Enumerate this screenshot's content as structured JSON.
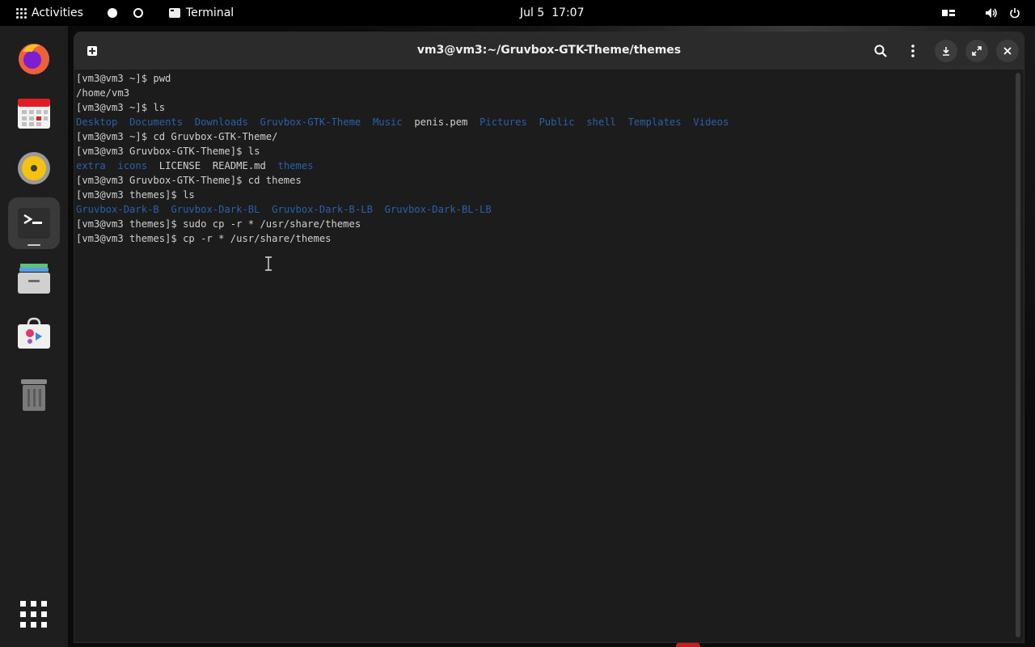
{
  "topbar": {
    "activities": "Activities",
    "app_name": "Terminal",
    "clock": "Jul 5  17:07"
  },
  "dock": {
    "items": [
      "firefox-icon",
      "calendar-icon",
      "rhythmbox-icon",
      "terminal-icon",
      "files-icon",
      "software-icon",
      "trash-icon",
      "app-grid-icon"
    ]
  },
  "window": {
    "title": "vm3@vm3:~/Gruvbox-GTK-Theme/themes"
  },
  "terminal": {
    "lines": [
      {
        "text": "[vm3@vm3 ~]$ pwd"
      },
      {
        "text": "/home/vm3"
      },
      {
        "text": "[vm3@vm3 ~]$ ls"
      },
      {
        "ls": [
          {
            "name": "Desktop",
            "type": "dir"
          },
          {
            "name": "Documents",
            "type": "dir"
          },
          {
            "name": "Downloads",
            "type": "dir"
          },
          {
            "name": "Gruvbox-GTK-Theme",
            "type": "dir"
          },
          {
            "name": "Music",
            "type": "dir"
          },
          {
            "name": "penis.pem",
            "type": "file"
          },
          {
            "name": "Pictures",
            "type": "dir"
          },
          {
            "name": "Public",
            "type": "dir"
          },
          {
            "name": "shell",
            "type": "dir"
          },
          {
            "name": "Templates",
            "type": "dir"
          },
          {
            "name": "Videos",
            "type": "dir"
          }
        ]
      },
      {
        "text": "[vm3@vm3 ~]$ cd Gruvbox-GTK-Theme/"
      },
      {
        "text": "[vm3@vm3 Gruvbox-GTK-Theme]$ ls"
      },
      {
        "ls": [
          {
            "name": "extra",
            "type": "dir"
          },
          {
            "name": "icons",
            "type": "dir"
          },
          {
            "name": "LICENSE",
            "type": "file"
          },
          {
            "name": "README.md",
            "type": "file"
          },
          {
            "name": "themes",
            "type": "dir"
          }
        ]
      },
      {
        "text": "[vm3@vm3 Gruvbox-GTK-Theme]$ cd themes"
      },
      {
        "text": "[vm3@vm3 themes]$ ls"
      },
      {
        "ls": [
          {
            "name": "Gruvbox-Dark-B",
            "type": "dir"
          },
          {
            "name": "Gruvbox-Dark-BL",
            "type": "dir"
          },
          {
            "name": "Gruvbox-Dark-B-LB",
            "type": "dir"
          },
          {
            "name": "Gruvbox-Dark-BL-LB",
            "type": "dir"
          }
        ]
      },
      {
        "text": "[vm3@vm3 themes]$ sudo cp -r * /usr/share/themes"
      },
      {
        "text": "[vm3@vm3 themes]$ cp -r * /usr/share/themes"
      }
    ]
  },
  "colors": {
    "dir": "#2a60a8",
    "text": "#d0d0d0",
    "terminal_bg": "#1c1c1c",
    "titlebar_bg": "#2b2b2b"
  }
}
